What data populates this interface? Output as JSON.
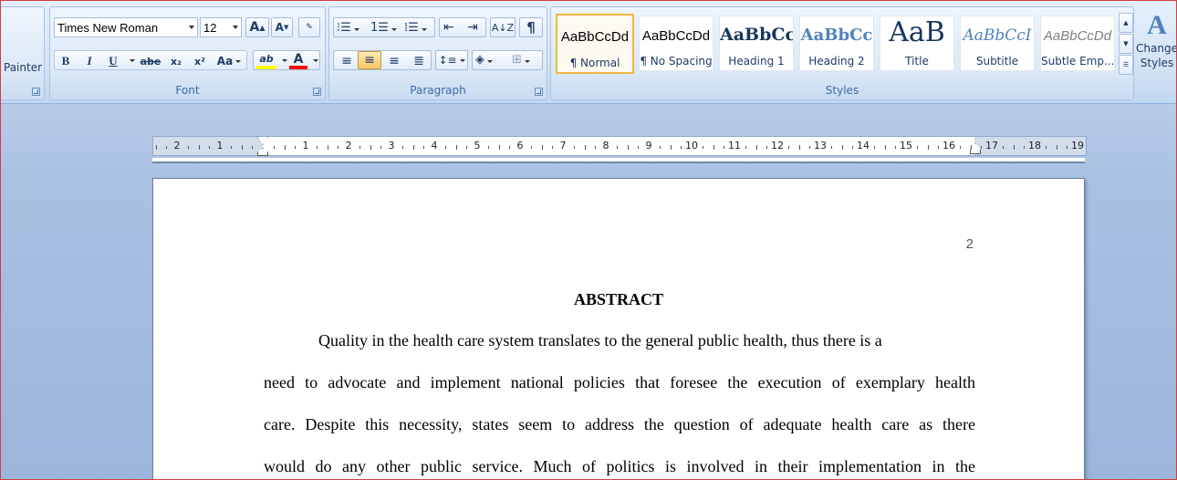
{
  "clipboard": {
    "painter_label": "Painter"
  },
  "font": {
    "name": "Times New Roman",
    "size": "12",
    "group_label": "Font",
    "grow_label": "A",
    "shrink_label": "A",
    "bold": "B",
    "italic": "I",
    "underline": "U",
    "strike": "abe",
    "subscript": "x₂",
    "superscript": "x²",
    "change_case": "Aa",
    "highlight": "ab",
    "font_color": "A"
  },
  "paragraph": {
    "group_label": "Paragraph",
    "pilcrow": "¶"
  },
  "styles": {
    "group_label": "Styles",
    "items": [
      {
        "sample": "AaBbCcDd",
        "name": "¶ Normal"
      },
      {
        "sample": "AaBbCcDd",
        "name": "¶ No Spacing"
      },
      {
        "sample": "AaBbCc",
        "name": "Heading 1"
      },
      {
        "sample": "AaBbCc",
        "name": "Heading 2"
      },
      {
        "sample": "AaB",
        "name": "Title"
      },
      {
        "sample": "AaBbCcI",
        "name": "Subtitle"
      },
      {
        "sample": "AaBbCcDd",
        "name": "Subtle Emp..."
      }
    ],
    "change_styles_line1": "Change",
    "change_styles_line2": "Styles"
  },
  "ruler": {
    "numbers": [
      "2",
      "1",
      "1",
      "2",
      "3",
      "4",
      "5",
      "6",
      "7",
      "8",
      "9",
      "10",
      "11",
      "12",
      "13",
      "14",
      "15",
      "16",
      "17",
      "18",
      "19"
    ]
  },
  "document": {
    "page_number": "2",
    "heading": "ABSTRACT",
    "lines": [
      "Quality in the health care system translates to the general public health, thus there is a",
      "need to advocate and implement national policies that foresee the execution of exemplary health",
      "care. Despite this necessity, states seem to address the question of adequate health care as there",
      "would do any other public service. Much of politics is involved in their implementation in the"
    ]
  },
  "colors": {
    "highlight": "#ffff00",
    "font_color": "#ff0000",
    "selected_style_border": "#f0b743"
  }
}
